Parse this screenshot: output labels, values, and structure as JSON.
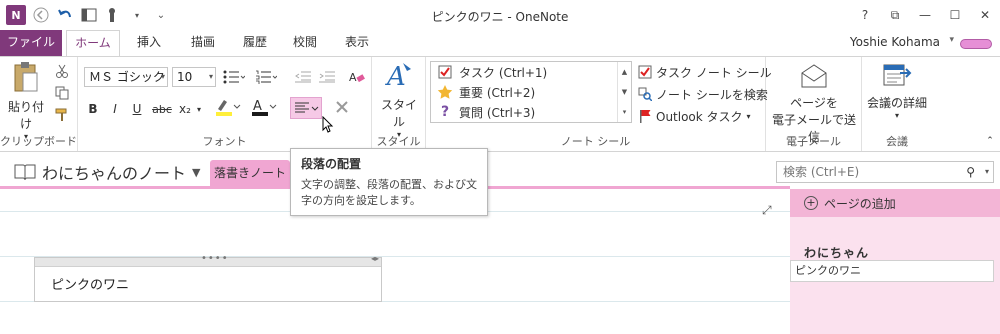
{
  "window": {
    "title": "ピンクのワニ - OneNote",
    "app_logo": "N",
    "controls": [
      "?",
      "⧉",
      "—",
      "☐",
      "✕"
    ]
  },
  "tabs": [
    {
      "label": "ファイル"
    },
    {
      "label": "ホーム"
    },
    {
      "label": "挿入"
    },
    {
      "label": "描画"
    },
    {
      "label": "履歴"
    },
    {
      "label": "校閲"
    },
    {
      "label": "表示"
    }
  ],
  "user": {
    "name": "Yoshie Kohama"
  },
  "ribbon": {
    "clipboard": {
      "paste_label": "貼り付け",
      "group_label": "クリップボード"
    },
    "font": {
      "font_name": "ＭＳ ゴシック",
      "font_size": "10",
      "bold": "B",
      "italic": "I",
      "underline": "U",
      "strike": "abc",
      "subscript": "x₂",
      "font_color": "A",
      "group_label": "フォント"
    },
    "styles": {
      "label": "スタイル",
      "group_label": "スタイル"
    },
    "tags": {
      "items": [
        {
          "label": "タスク (Ctrl+1)"
        },
        {
          "label": "重要 (Ctrl+2)"
        },
        {
          "label": "質問 (Ctrl+3)"
        }
      ],
      "side": [
        {
          "label": "タスク ノート シール"
        },
        {
          "label": "ノート シールを検索"
        },
        {
          "label": "Outlook タスク"
        }
      ],
      "group_label": "ノート シール"
    },
    "email": {
      "label_line1": "ページを",
      "label_line2": "電子メールで送信",
      "group_label": "電子メール"
    },
    "meetings": {
      "label": "会議の詳細",
      "group_label": "会議"
    }
  },
  "notebook": {
    "title": "わにちゃんのノート",
    "section_tab": "落書きノート",
    "search_placeholder": "検索 (Ctrl+E)"
  },
  "tooltip": {
    "title": "段落の配置",
    "body": "文字の調整、段落の配置、および文字の方向を設定します。"
  },
  "page": {
    "note_text": "ピンクのワニ"
  },
  "pages_panel": {
    "add_page": "ページの追加",
    "section_name": "わにちゃん",
    "items": [
      {
        "label": "ピンクのワニ"
      }
    ]
  },
  "colors": {
    "accent": "#80397b",
    "section_pink": "#f0a6d2",
    "panel_pink": "#fbe1ee"
  }
}
